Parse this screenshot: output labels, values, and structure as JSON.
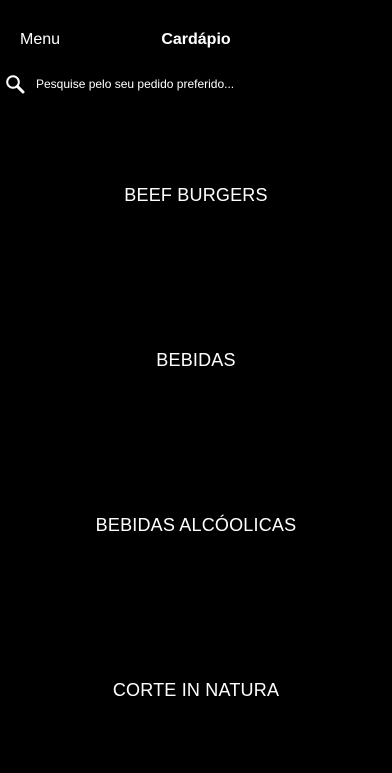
{
  "nav": {
    "menu_label": "Menu",
    "title": "Cardápio"
  },
  "search": {
    "placeholder": "Pesquise pelo seu pedido preferido...",
    "icon": "search-icon"
  },
  "categories": [
    {
      "label": "BEEF BURGERS"
    },
    {
      "label": "BEBIDAS"
    },
    {
      "label": "BEBIDAS ALCÓOLICAS"
    },
    {
      "label": "CORTE IN NATURA"
    }
  ],
  "colors": {
    "background": "#000000",
    "text": "#ffffff"
  }
}
